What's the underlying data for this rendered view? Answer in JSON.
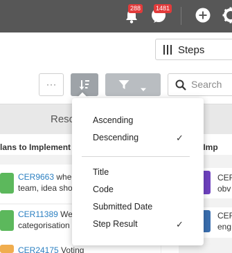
{
  "topbar": {
    "notifications_count": "288",
    "messages_count": "1481"
  },
  "view_switcher": {
    "label": "Steps"
  },
  "toolbar": {
    "search_placeholder": "Search"
  },
  "columns": {
    "middle_title": "Reso"
  },
  "lanes": {
    "left_title": "lans to Implement",
    "right_title": "ally Imp"
  },
  "cards": [
    {
      "code": "CER9663",
      "line1_rest": " wher",
      "line2": "team, idea sho"
    },
    {
      "code": "CER11389",
      "line1_rest": " We",
      "line2": "categorisation"
    },
    {
      "code": "CER24175",
      "line1_rest": " Voting",
      "line2": ""
    }
  ],
  "right_cards": [
    {
      "code": "CER",
      "line2": "obv"
    },
    {
      "code": "CER",
      "line2": "eng"
    }
  ],
  "sort_menu": {
    "direction": [
      {
        "label": "Ascending",
        "checked": false
      },
      {
        "label": "Descending",
        "checked": true
      }
    ],
    "fields": [
      {
        "label": "Title",
        "checked": false
      },
      {
        "label": "Code",
        "checked": false
      },
      {
        "label": "Submitted Date",
        "checked": false
      },
      {
        "label": "Step Result",
        "checked": true
      }
    ],
    "check_glyph": "✓"
  },
  "colors": {
    "topbar": "#575757",
    "badge": "#e23b3b",
    "link": "#2a7fc1",
    "card_green": "#5cb85c",
    "card_purple": "#6f42c1",
    "card_blue": "#3a6fb0",
    "card_orange": "#f0ad4e"
  }
}
